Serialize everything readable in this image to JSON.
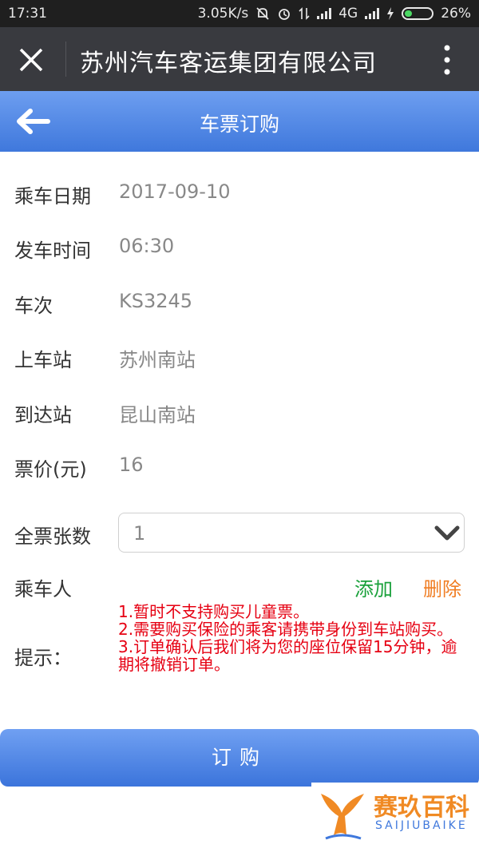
{
  "status_bar": {
    "time": "17:31",
    "speed": "3.05K/s",
    "network": "4G",
    "battery": "26%"
  },
  "title_bar": {
    "title": "苏州汽车客运集团有限公司"
  },
  "page_header": {
    "title": "车票订购"
  },
  "form": {
    "date": {
      "label": "乘车日期",
      "value": "2017-09-10"
    },
    "departure_time": {
      "label": "发车时间",
      "value": "06:30"
    },
    "trip": {
      "label": "车次",
      "value": "KS3245"
    },
    "boarding": {
      "label": "上车站",
      "value": "苏州南站"
    },
    "destination": {
      "label": "到达站",
      "value": "昆山南站"
    },
    "price": {
      "label": "票价(元)",
      "value": "16"
    },
    "full_ticket": {
      "label": "全票张数",
      "selected": "1"
    },
    "passenger": {
      "label": "乘车人",
      "add": "添加",
      "delete": "删除"
    },
    "tips": {
      "label": "提示：",
      "items": [
        "1.暂时不支持购买儿童票。",
        "2.需要购买保险的乘客请携带身份到车站购买。",
        "3.订单确认后我们将为您的座位保留15分钟，逾期将撤销订单。"
      ]
    }
  },
  "order_button": {
    "label": "订购"
  },
  "watermark": {
    "name": "赛玖百科",
    "sub": "SAIJIUBAIKE"
  },
  "colors": {
    "header_blue": "#3f78dc",
    "add_green": "#1aa13b",
    "delete_orange": "#f07d22",
    "tips_red": "#e60012"
  }
}
